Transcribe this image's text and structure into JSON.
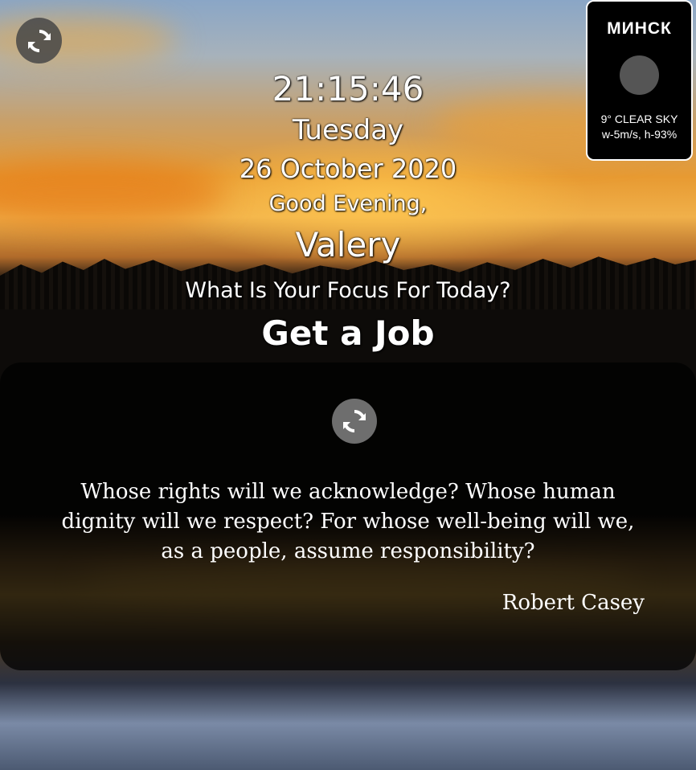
{
  "clock": {
    "time": "21:15:46",
    "day": "Tuesday",
    "date": "26 October 2020"
  },
  "greeting": {
    "text": "Good Evening,",
    "name": "Valery"
  },
  "focus": {
    "question": "What Is Your Focus For Today?",
    "value": "Get a Job"
  },
  "weather": {
    "city": "МИНСК",
    "icon": "weather-icon-placeholder",
    "summary": "9° CLEAR SKY",
    "details": "w-5m/s, h-93%"
  },
  "quote": {
    "text": "Whose rights will we acknowledge? Whose human dignity will we respect? For whose well-being will we, as a people, assume responsibility?",
    "author": "Robert Casey"
  },
  "icons": {
    "refresh_background": "refresh-icon",
    "refresh_quote": "refresh-icon"
  },
  "colors": {
    "refresh_bg_button": "#464646",
    "refresh_quote_button": "#6e6e6e",
    "weather_bg": "#000000",
    "weather_border": "#ffffff",
    "quote_panel_bg": "#000000",
    "text": "#ffffff"
  }
}
